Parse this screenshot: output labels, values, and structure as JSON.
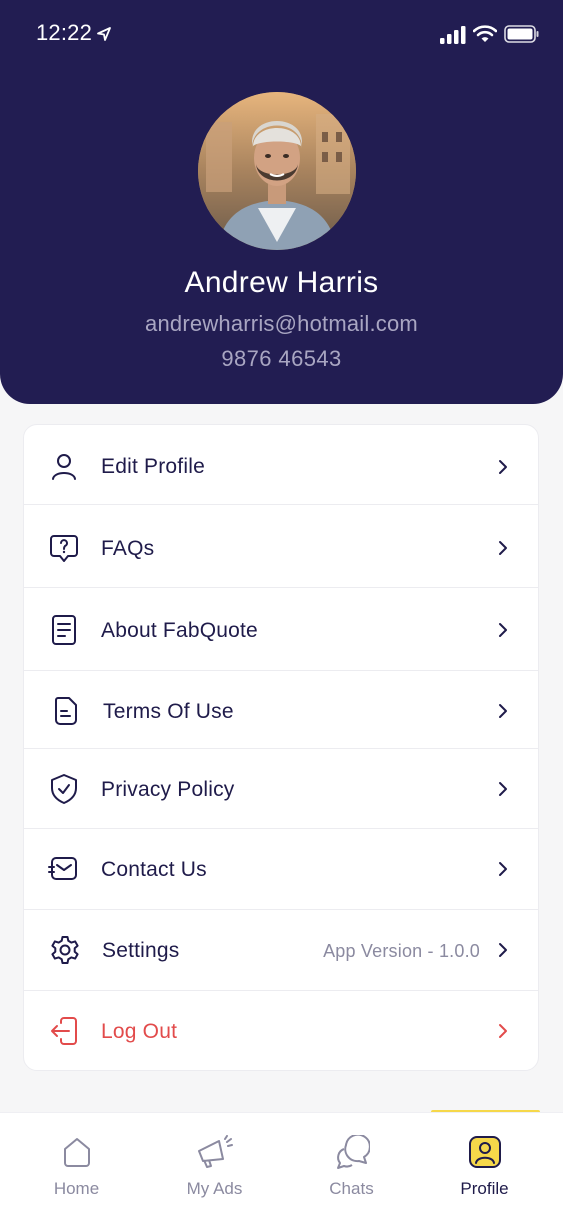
{
  "status_bar": {
    "time": "12:22"
  },
  "profile": {
    "name": "Andrew Harris",
    "email": "andrewharris@hotmail.com",
    "phone": "9876 46543"
  },
  "menu": {
    "edit_profile": "Edit Profile",
    "faqs": "FAQs",
    "about": "About FabQuote",
    "terms": "Terms Of Use",
    "privacy": "Privacy Policy",
    "contact": "Contact Us",
    "settings": "Settings",
    "app_version": "App Version - 1.0.0",
    "logout": "Log Out"
  },
  "tabs": {
    "home": "Home",
    "my_ads": "My Ads",
    "chats": "Chats",
    "profile": "Profile",
    "active": "profile"
  },
  "colors": {
    "header_bg": "#221d52",
    "accent_yellow": "#f6d84a",
    "logout_red": "#e24b4b",
    "text_dark": "#1f1b4a"
  }
}
